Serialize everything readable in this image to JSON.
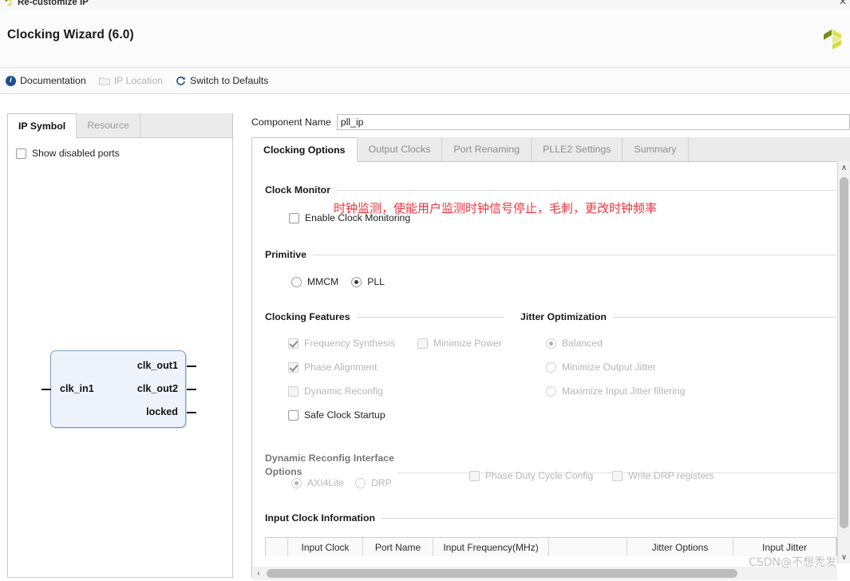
{
  "window": {
    "title": "Re-customize IP",
    "close_glyph": "✕",
    "app_icon": "xilinx-logo-icon"
  },
  "header": {
    "title": "Clocking Wizard (6.0)",
    "logo": "xilinx-logo-icon"
  },
  "toolbar": {
    "items": [
      {
        "label": "Documentation",
        "icon": "info-icon",
        "disabled": false
      },
      {
        "label": "IP Location",
        "icon": "folder-icon",
        "disabled": true
      },
      {
        "label": "Switch to Defaults",
        "icon": "refresh-icon",
        "disabled": false
      }
    ]
  },
  "left_panel": {
    "tabs": [
      {
        "label": "IP Symbol",
        "active": true
      },
      {
        "label": "Resource",
        "active": false
      }
    ],
    "show_disabled_ports": {
      "label": "Show disabled ports",
      "checked": false
    },
    "symbol": {
      "input_pins": [
        "clk_in1"
      ],
      "output_pins": [
        "clk_out1",
        "clk_out2",
        "locked"
      ],
      "fill_color": "#eef3fb",
      "border_color": "#7e9ec9"
    }
  },
  "component_name": {
    "label": "Component Name",
    "value": "pll_ip",
    "placeholder": ""
  },
  "right_panel": {
    "tabs": [
      {
        "label": "Clocking Options",
        "active": true
      },
      {
        "label": "Output Clocks",
        "active": false
      },
      {
        "label": "Port Renaming",
        "active": false
      },
      {
        "label": "PLLE2 Settings",
        "active": false
      },
      {
        "label": "Summary",
        "active": false
      }
    ]
  },
  "clock_monitor": {
    "heading": "Clock Monitor",
    "annotation": "时钟监测，使能用户监测时钟信号停止，毛刺，更改时钟频率",
    "annotation_color": "#f0323c",
    "enable": {
      "label": "Enable Clock Monitoring",
      "checked": false,
      "disabled": false
    }
  },
  "primitive": {
    "heading": "Primitive",
    "options": [
      {
        "label": "MMCM",
        "selected": false,
        "disabled": false
      },
      {
        "label": "PLL",
        "selected": true,
        "disabled": false
      }
    ]
  },
  "clocking_features": {
    "heading": "Clocking Features",
    "items": [
      {
        "label": "Frequency Synthesis",
        "checked": true,
        "disabled": true
      },
      {
        "label": "Minimize Power",
        "checked": false,
        "disabled": true
      },
      {
        "label": "Phase Alignment",
        "checked": true,
        "disabled": true
      },
      {
        "label": "Dynamic Reconfig",
        "checked": false,
        "disabled": true
      },
      {
        "label": "Safe Clock Startup",
        "checked": false,
        "disabled": false
      }
    ]
  },
  "jitter_optimization": {
    "heading": "Jitter Optimization",
    "options": [
      {
        "label": "Balanced",
        "selected": true,
        "disabled": true
      },
      {
        "label": "Minimize Output Jitter",
        "selected": false,
        "disabled": true
      },
      {
        "label": "Maximize Input Jitter filtering",
        "selected": false,
        "disabled": true
      }
    ]
  },
  "dynamic_reconfig": {
    "heading_line1": "Dynamic Reconfig Interface",
    "heading_line2": "Options",
    "interface_options": [
      {
        "label": "AXI4Lite",
        "selected": true,
        "disabled": true
      },
      {
        "label": "DRP",
        "selected": false,
        "disabled": true
      }
    ],
    "checkboxes": [
      {
        "label": "Phase Duty Cycle Config",
        "checked": false,
        "disabled": true
      },
      {
        "label": "Write DRP registers",
        "checked": false,
        "disabled": true
      }
    ]
  },
  "input_clock_information": {
    "heading": "Input Clock Information",
    "columns": [
      "",
      "Input Clock",
      "Port Name",
      "Input Frequency(MHz)",
      "",
      "Jitter Options",
      "Input Jitter"
    ],
    "rows": []
  },
  "scrollbars": {
    "vertical": {
      "up_glyph": "∧",
      "down_glyph": "∨"
    },
    "horizontal": {
      "left_glyph": "‹",
      "right_glyph": "›"
    }
  },
  "watermark": {
    "text": "CSDN@不想秃发"
  }
}
